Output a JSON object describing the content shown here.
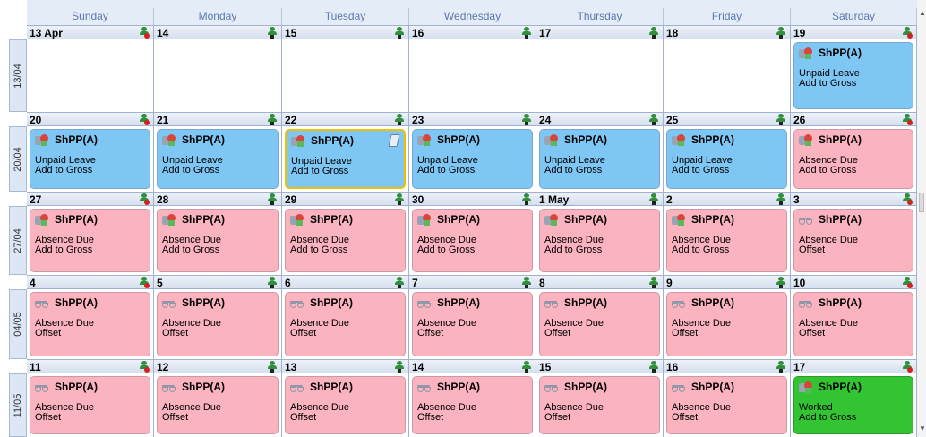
{
  "days": [
    "Sunday",
    "Monday",
    "Tuesday",
    "Wednesday",
    "Thursday",
    "Friday",
    "Saturday"
  ],
  "weeks": [
    {
      "label": "13/04",
      "cells": [
        {
          "date": "13 Apr",
          "icon": "rest",
          "entry": null
        },
        {
          "date": "14",
          "icon": "work",
          "entry": null
        },
        {
          "date": "15",
          "icon": "work",
          "entry": null
        },
        {
          "date": "16",
          "icon": "work",
          "entry": null
        },
        {
          "date": "17",
          "icon": "work",
          "entry": null
        },
        {
          "date": "18",
          "icon": "work",
          "entry": null
        },
        {
          "date": "19",
          "icon": "rest",
          "entry": {
            "color": "blue",
            "code": "ShPP(A)",
            "line1": "Unpaid Leave",
            "line2": "Add to Gross",
            "eicon": "leave"
          }
        }
      ]
    },
    {
      "label": "20/04",
      "cells": [
        {
          "date": "20",
          "icon": "rest",
          "entry": {
            "color": "blue",
            "code": "ShPP(A)",
            "line1": "Unpaid Leave",
            "line2": "Add to Gross",
            "eicon": "leave"
          }
        },
        {
          "date": "21",
          "icon": "work",
          "entry": {
            "color": "blue",
            "code": "ShPP(A)",
            "line1": "Unpaid Leave",
            "line2": "Add to Gross",
            "eicon": "leave"
          }
        },
        {
          "date": "22",
          "icon": "work",
          "entry": {
            "color": "blue",
            "code": "ShPP(A)",
            "line1": "Unpaid Leave",
            "line2": "Add to Gross",
            "eicon": "leave",
            "selected": true,
            "note": true
          }
        },
        {
          "date": "23",
          "icon": "work",
          "entry": {
            "color": "blue",
            "code": "ShPP(A)",
            "line1": "Unpaid Leave",
            "line2": "Add to Gross",
            "eicon": "leave"
          }
        },
        {
          "date": "24",
          "icon": "work",
          "entry": {
            "color": "blue",
            "code": "ShPP(A)",
            "line1": "Unpaid Leave",
            "line2": "Add to Gross",
            "eicon": "leave"
          }
        },
        {
          "date": "25",
          "icon": "work",
          "entry": {
            "color": "blue",
            "code": "ShPP(A)",
            "line1": "Unpaid Leave",
            "line2": "Add to Gross",
            "eicon": "leave"
          }
        },
        {
          "date": "26",
          "icon": "rest",
          "entry": {
            "color": "pink",
            "code": "ShPP(A)",
            "line1": "Absence Due",
            "line2": "Add to Gross",
            "eicon": "leave"
          }
        }
      ]
    },
    {
      "label": "27/04",
      "cells": [
        {
          "date": "27",
          "icon": "rest",
          "entry": {
            "color": "pink",
            "code": "ShPP(A)",
            "line1": "Absence Due",
            "line2": "Add to Gross",
            "eicon": "leave"
          }
        },
        {
          "date": "28",
          "icon": "work",
          "entry": {
            "color": "pink",
            "code": "ShPP(A)",
            "line1": "Absence Due",
            "line2": "Add to Gross",
            "eicon": "leave"
          }
        },
        {
          "date": "29",
          "icon": "work",
          "entry": {
            "color": "pink",
            "code": "ShPP(A)",
            "line1": "Absence Due",
            "line2": "Add to Gross",
            "eicon": "leave"
          }
        },
        {
          "date": "30",
          "icon": "work",
          "entry": {
            "color": "pink",
            "code": "ShPP(A)",
            "line1": "Absence Due",
            "line2": "Add to Gross",
            "eicon": "leave"
          }
        },
        {
          "date": "1 May",
          "icon": "work",
          "entry": {
            "color": "pink",
            "code": "ShPP(A)",
            "line1": "Absence Due",
            "line2": "Add to Gross",
            "eicon": "leave"
          }
        },
        {
          "date": "2",
          "icon": "work",
          "entry": {
            "color": "pink",
            "code": "ShPP(A)",
            "line1": "Absence Due",
            "line2": "Add to Gross",
            "eicon": "leave"
          }
        },
        {
          "date": "3",
          "icon": "rest",
          "entry": {
            "color": "pink",
            "code": "ShPP(A)",
            "line1": "Absence Due",
            "line2": "Offset",
            "eicon": "scale"
          }
        }
      ]
    },
    {
      "label": "04/05",
      "cells": [
        {
          "date": "4",
          "icon": "rest",
          "entry": {
            "color": "pink",
            "code": "ShPP(A)",
            "line1": "Absence Due",
            "line2": "Offset",
            "eicon": "scale"
          }
        },
        {
          "date": "5",
          "icon": "work",
          "entry": {
            "color": "pink",
            "code": "ShPP(A)",
            "line1": "Absence Due",
            "line2": "Offset",
            "eicon": "scale"
          }
        },
        {
          "date": "6",
          "icon": "work",
          "entry": {
            "color": "pink",
            "code": "ShPP(A)",
            "line1": "Absence Due",
            "line2": "Offset",
            "eicon": "scale"
          }
        },
        {
          "date": "7",
          "icon": "work",
          "entry": {
            "color": "pink",
            "code": "ShPP(A)",
            "line1": "Absence Due",
            "line2": "Offset",
            "eicon": "scale"
          }
        },
        {
          "date": "8",
          "icon": "work",
          "entry": {
            "color": "pink",
            "code": "ShPP(A)",
            "line1": "Absence Due",
            "line2": "Offset",
            "eicon": "scale"
          }
        },
        {
          "date": "9",
          "icon": "work",
          "entry": {
            "color": "pink",
            "code": "ShPP(A)",
            "line1": "Absence Due",
            "line2": "Offset",
            "eicon": "scale"
          }
        },
        {
          "date": "10",
          "icon": "rest",
          "entry": {
            "color": "pink",
            "code": "ShPP(A)",
            "line1": "Absence Due",
            "line2": "Offset",
            "eicon": "scale"
          }
        }
      ]
    },
    {
      "label": "11/05",
      "cells": [
        {
          "date": "11",
          "icon": "rest",
          "entry": {
            "color": "pink",
            "code": "ShPP(A)",
            "line1": "Absence Due",
            "line2": "Offset",
            "eicon": "scale"
          }
        },
        {
          "date": "12",
          "icon": "work",
          "entry": {
            "color": "pink",
            "code": "ShPP(A)",
            "line1": "Absence Due",
            "line2": "Offset",
            "eicon": "scale"
          }
        },
        {
          "date": "13",
          "icon": "work",
          "entry": {
            "color": "pink",
            "code": "ShPP(A)",
            "line1": "Absence Due",
            "line2": "Offset",
            "eicon": "scale"
          }
        },
        {
          "date": "14",
          "icon": "work",
          "entry": {
            "color": "pink",
            "code": "ShPP(A)",
            "line1": "Absence Due",
            "line2": "Offset",
            "eicon": "scale"
          }
        },
        {
          "date": "15",
          "icon": "work",
          "entry": {
            "color": "pink",
            "code": "ShPP(A)",
            "line1": "Absence Due",
            "line2": "Offset",
            "eicon": "scale"
          }
        },
        {
          "date": "16",
          "icon": "work",
          "entry": {
            "color": "pink",
            "code": "ShPP(A)",
            "line1": "Absence Due",
            "line2": "Offset",
            "eicon": "scale"
          }
        },
        {
          "date": "17",
          "icon": "rest",
          "entry": {
            "color": "green",
            "code": "ShPP(A)",
            "line1": "Worked",
            "line2": "Add to Gross",
            "eicon": "leave"
          }
        }
      ]
    }
  ]
}
